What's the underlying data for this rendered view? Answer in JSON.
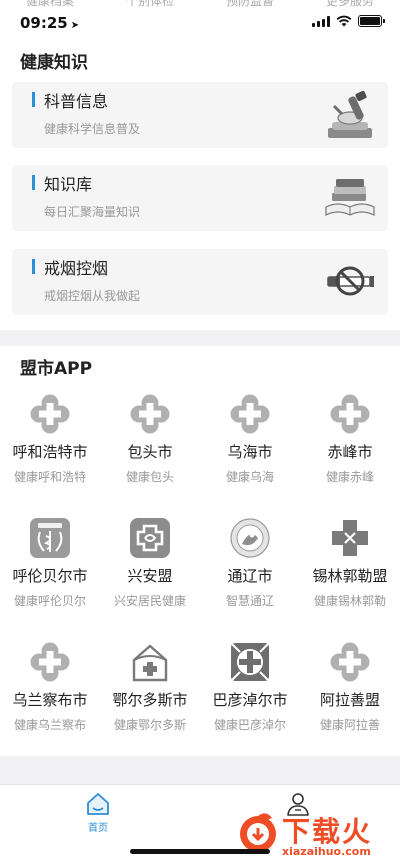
{
  "status_bar": {
    "time": "09:25",
    "ghost_tabs": [
      "健康档案",
      "个别体检",
      "预防监督",
      "更多服务"
    ]
  },
  "health_knowledge": {
    "title": "健康知识",
    "accent_color": "#2a8ed9",
    "cards": [
      {
        "title": "科普信息",
        "subtitle": "健康科学信息普及",
        "icon": "microscope-icon"
      },
      {
        "title": "知识库",
        "subtitle": "每日汇聚海量知识",
        "icon": "books-icon"
      },
      {
        "title": "戒烟控烟",
        "subtitle": "戒烟控烟从我做起",
        "icon": "no-smoking-icon"
      }
    ]
  },
  "apps_section": {
    "title": "盟市APP",
    "apps": [
      {
        "name": "呼和浩特市",
        "subtitle": "健康呼和浩特",
        "icon": "health-cross-icon"
      },
      {
        "name": "包头市",
        "subtitle": "健康包头",
        "icon": "health-cross-icon"
      },
      {
        "name": "乌海市",
        "subtitle": "健康乌海",
        "icon": "health-cross-icon"
      },
      {
        "name": "赤峰市",
        "subtitle": "健康赤峰",
        "icon": "health-cross-icon"
      },
      {
        "name": "呼伦贝尔市",
        "subtitle": "健康呼伦贝尔",
        "icon": "nhfpc-emblem-icon"
      },
      {
        "name": "兴安盟",
        "subtitle": "兴安居民健康",
        "icon": "xingan-logo-icon"
      },
      {
        "name": "通辽市",
        "subtitle": "智慧通辽",
        "icon": "tongliao-seal-icon"
      },
      {
        "name": "锡林郭勒盟",
        "subtitle": "健康锡林郭勒",
        "icon": "xilingol-cross-icon"
      },
      {
        "name": "乌兰察布市",
        "subtitle": "健康乌兰察布",
        "icon": "health-cross-icon"
      },
      {
        "name": "鄂尔多斯市",
        "subtitle": "健康鄂尔多斯",
        "icon": "ordos-house-icon"
      },
      {
        "name": "巴彦淖尔市",
        "subtitle": "健康巴彦淖尔",
        "icon": "bayannur-logo-icon"
      },
      {
        "name": "阿拉善盟",
        "subtitle": "健康阿拉善",
        "icon": "health-cross-icon"
      }
    ]
  },
  "tab_bar": {
    "home_label": "首页",
    "active_color": "#2a8ed9"
  },
  "watermark": {
    "text": "下载火",
    "url": "xiazaihuo.com"
  }
}
